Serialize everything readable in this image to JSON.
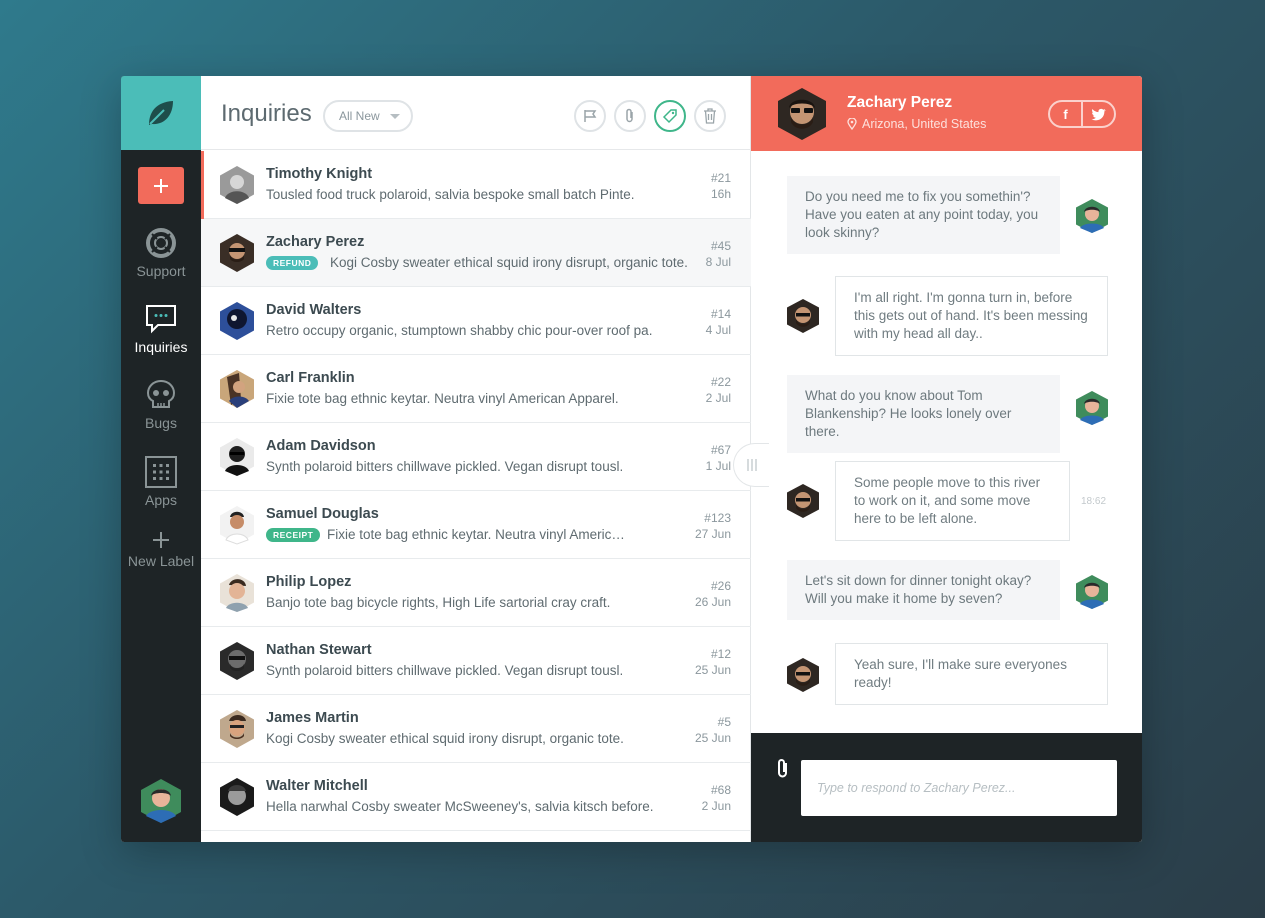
{
  "colors": {
    "teal": "#4bbdb8",
    "coral": "#f26b5b",
    "dark": "#1e2426",
    "green": "#3fb68a"
  },
  "sidebar": {
    "add_icon": "plus-icon",
    "items": [
      {
        "label": "Support",
        "icon": "lifebuoy-icon"
      },
      {
        "label": "Inquiries",
        "icon": "chat-bubble-icon"
      },
      {
        "label": "Bugs",
        "icon": "skull-icon"
      },
      {
        "label": "Apps",
        "icon": "grid-icon"
      },
      {
        "label": "New Label",
        "icon": "plus-icon"
      }
    ]
  },
  "list": {
    "title": "Inquiries",
    "filter": "All New",
    "tools": [
      "flag-icon",
      "paperclip-icon",
      "tag-icon",
      "trash-icon"
    ],
    "rows": [
      {
        "name": "Timothy Knight",
        "snippet": "Tousled food truck polaroid, salvia bespoke small batch Pinte.",
        "num": "#21",
        "date": "16h",
        "tag": ""
      },
      {
        "name": "Zachary Perez",
        "snippet": "Kogi Cosby sweater ethical squid irony disrupt, organic tote.",
        "num": "#45",
        "date": "8 Jul",
        "tag": "REFUND"
      },
      {
        "name": "David Walters",
        "snippet": "Retro occupy organic, stumptown shabby chic pour-over roof pa.",
        "num": "#14",
        "date": "4 Jul",
        "tag": ""
      },
      {
        "name": "Carl Franklin",
        "snippet": "Fixie tote bag ethnic keytar. Neutra vinyl American Apparel.",
        "num": "#22",
        "date": "2 Jul",
        "tag": ""
      },
      {
        "name": "Adam Davidson",
        "snippet": "Synth polaroid bitters chillwave pickled. Vegan disrupt tousl.",
        "num": "#67",
        "date": "1 Jul",
        "tag": ""
      },
      {
        "name": "Samuel Douglas",
        "snippet": "Fixie tote bag ethnic keytar. Neutra vinyl American Apparel.",
        "num": "#123",
        "date": "27 Jun",
        "tag": "RECEIPT"
      },
      {
        "name": "Philip Lopez",
        "snippet": "Banjo tote bag bicycle rights, High Life sartorial cray craft.",
        "num": "#26",
        "date": "26 Jun",
        "tag": ""
      },
      {
        "name": "Nathan Stewart",
        "snippet": "Synth polaroid bitters chillwave pickled. Vegan disrupt tousl.",
        "num": "#12",
        "date": "25 Jun",
        "tag": ""
      },
      {
        "name": "James Martin",
        "snippet": "Kogi Cosby sweater ethical squid irony disrupt, organic tote.",
        "num": "#5",
        "date": "25 Jun",
        "tag": ""
      },
      {
        "name": "Walter Mitchell",
        "snippet": "Hella narwhal Cosby sweater McSweeney's, salvia kitsch before.",
        "num": "#68",
        "date": "2 Jun",
        "tag": ""
      }
    ]
  },
  "chat": {
    "name": "Zachary Perez",
    "location": "Arizona, United States",
    "social": [
      "f",
      "twitter-icon"
    ],
    "messages": [
      {
        "text": "Do you need me to fix you somethin'? Have you eaten at any point today, you look skinny?",
        "from": "agent"
      },
      {
        "text": "I'm all right. I'm gonna turn in, before this gets out of hand. It's been messing with my head all day..",
        "from": "customer"
      },
      {
        "text": "What do you know about Tom Blankenship? He looks lonely over there.",
        "from": "agent"
      },
      {
        "text": "Some people move to this river to work on it, and some move here to be left alone.",
        "from": "customer",
        "time": "18:62"
      },
      {
        "text": "Let's sit down for dinner tonight okay? Will you make it home by seven?",
        "from": "agent"
      },
      {
        "text": "Yeah sure, I'll make sure everyones ready!",
        "from": "customer"
      }
    ],
    "composer_placeholder": "Type to respond to Zachary Perez..."
  }
}
